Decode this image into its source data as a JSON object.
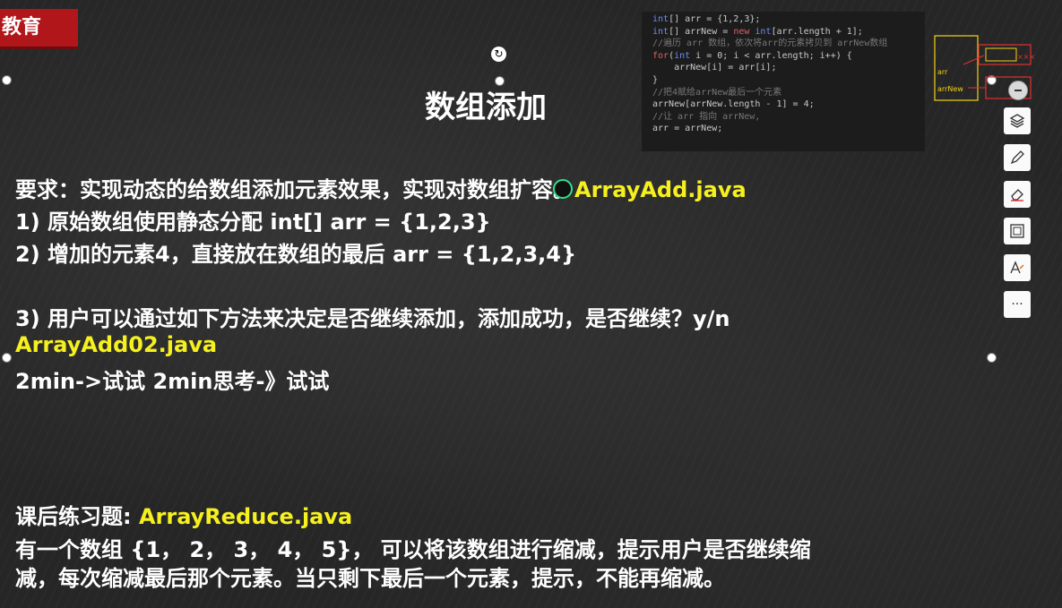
{
  "logo": {
    "text": "教育"
  },
  "slide": {
    "title": "数组添加",
    "requirement_prefix": "要求：实现动态的给数组添加元素效果，实现对数组扩容。",
    "requirement_file": "ArrayAdd.java",
    "item1": "1) 原始数组使用静态分配 int[] arr = {1,2,3}",
    "item2": "2) 增加的元素4，直接放在数组的最后 arr = {1,2,3,4}",
    "item3": "3) 用户可以通过如下方法来决定是否继续添加，添加成功，是否继续？y/n",
    "item3_file": "ArrayAdd02.java",
    "timing": "2min->试试 2min思考-》试试",
    "exercise_label": "课后练习题: ",
    "exercise_file": "ArrayReduce.java",
    "exercise_line1": "有一个数组 {1， 2， 3， 4， 5}， 可以将该数组进行缩减，提示用户是否继续缩",
    "exercise_line2": "减，每次缩减最后那个元素。当只剩下最后一个元素，提示，不能再缩减。"
  },
  "code": {
    "l1a": "int",
    "l1b": "[] arr = {1,2,3};",
    "l2a": "int",
    "l2b": "[] arrNew = ",
    "l2c": "new",
    "l2d": " ",
    "l2e": "int",
    "l2f": "[arr.length + 1];",
    "l3": "//遍历 arr 数组，依次将arr的元素拷贝到 arrNew数组",
    "l4a": "for",
    "l4b": "(",
    "l4c": "int",
    "l4d": " i = 0; i < arr.length; i++) {",
    "l5": "    arrNew[i] = arr[i];",
    "l6": "}",
    "l7": "//把4赋给arrNew最后一个元素",
    "l8": "arrNew[arrNew.length - 1] = 4;",
    "l9": "//让 arr 指向 arrNew,",
    "l10": "arr = arrNew;"
  },
  "sketch": {
    "label1": "arr",
    "label2": "arrNew",
    "mark": "×××"
  },
  "toolbar": {
    "icons": [
      "minus-icon",
      "layers-icon",
      "pen-icon",
      "eraser-icon",
      "frame-icon",
      "text-style-icon",
      "more-icon"
    ],
    "more_label": "···"
  },
  "colors": {
    "accent_yellow": "#f6f01e",
    "logo_red": "#b0161a",
    "cursor_green": "#2ee08a"
  }
}
